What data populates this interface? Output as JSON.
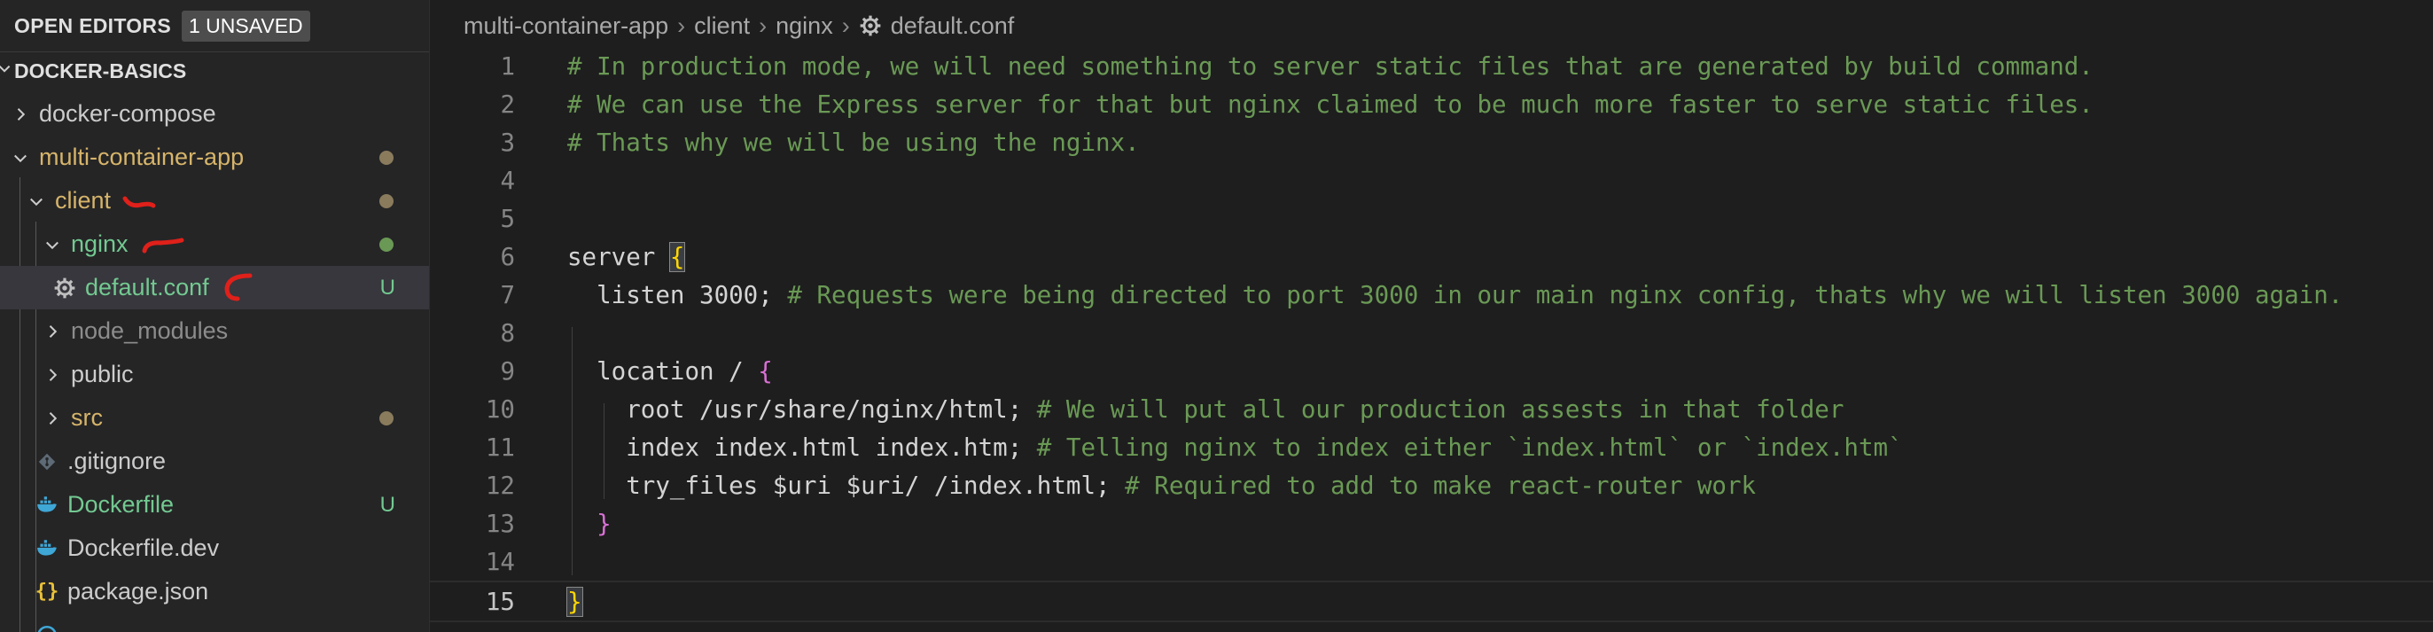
{
  "sidebar": {
    "open_editors_title": "OPEN EDITORS",
    "unsaved_badge": "1 UNSAVED",
    "root_title": "DOCKER-BASICS",
    "items": [
      {
        "label": "docker-compose"
      },
      {
        "label": "multi-container-app"
      },
      {
        "label": "client"
      },
      {
        "label": "nginx"
      },
      {
        "label": "default.conf",
        "status": "U"
      },
      {
        "label": "node_modules"
      },
      {
        "label": "public"
      },
      {
        "label": "src"
      },
      {
        "label": ".gitignore"
      },
      {
        "label": "Dockerfile",
        "status": "U"
      },
      {
        "label": "Dockerfile.dev"
      },
      {
        "label": "package.json",
        "icon_text": "{}"
      }
    ]
  },
  "breadcrumb": {
    "items": [
      "multi-container-app",
      "client",
      "nginx",
      "default.conf"
    ]
  },
  "editor": {
    "lines": [
      {
        "n": "1",
        "comment": "# In production mode, we will need something to server static files that are generated by build command."
      },
      {
        "n": "2",
        "comment": "# We can use the Express server for that but nginx claimed to be much more faster to serve static files."
      },
      {
        "n": "3",
        "comment": "# Thats why we will be using the nginx."
      },
      {
        "n": "4"
      },
      {
        "n": "5"
      },
      {
        "n": "6",
        "code": "server ",
        "brace": "{"
      },
      {
        "n": "7",
        "code": "  listen 3000;",
        "comment": " # Requests were being directed to port 3000 in our main nginx config, thats why we will listen 3000 again."
      },
      {
        "n": "8"
      },
      {
        "n": "9",
        "code": "  location / ",
        "brace": "{"
      },
      {
        "n": "10",
        "code": "    root /usr/share/nginx/html;",
        "comment": " # We will put all our production assests in that folder"
      },
      {
        "n": "11",
        "code": "    index index.html index.htm;",
        "comment": " # Telling nginx to index either `index.html` or `index.htm`"
      },
      {
        "n": "12",
        "code": "    try_files $uri $uri/ /index.html;",
        "comment": " # Required to add to make react-router work"
      },
      {
        "n": "13",
        "code": "  ",
        "brace": "}"
      },
      {
        "n": "14"
      },
      {
        "n": "15",
        "brace": "}"
      }
    ]
  },
  "colors": {
    "sidebar_bg": "#252526",
    "editor_bg": "#1e1e1e",
    "comment": "#6a9955",
    "brace_outer": "#ffd700",
    "brace_inner": "#da70d6",
    "untracked": "#73c991",
    "modified_folder": "#d6b46a",
    "annotation_red": "#e0201a"
  }
}
